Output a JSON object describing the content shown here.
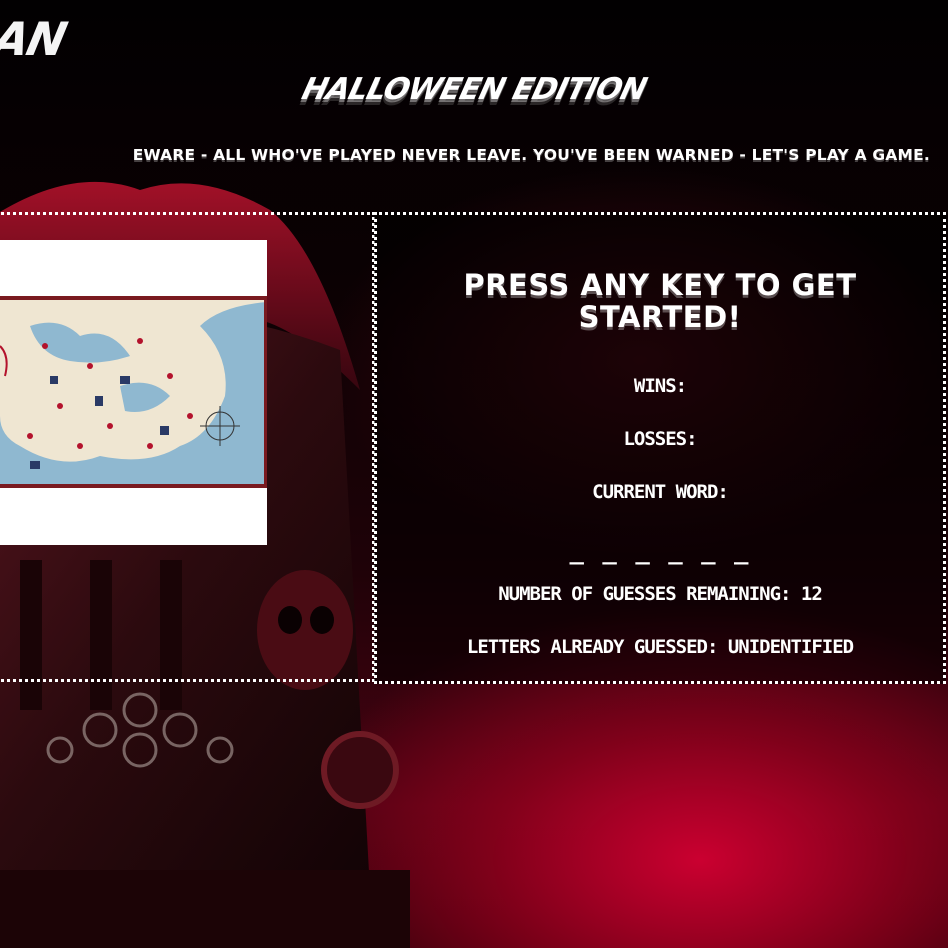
{
  "header": {
    "logo_text": "AN",
    "edition_title": "HALLOWEEN EDITION",
    "tagline": "EWARE - ALL WHO'VE PLAYED NEVER LEAVE. YOU'VE BEEN WARNED - LET'S PLAY A GAME."
  },
  "game": {
    "prompt": "PRESS ANY KEY TO GET STARTED!",
    "wins_label": "WINS:",
    "losses_label": "LOSSES:",
    "current_word_label": "CURRENT WORD:",
    "word_blanks": "_ _ _ _ _ _",
    "guesses_remaining_label": "NUMBER OF GUESSES REMAINING: 12",
    "letters_guessed_label": "LETTERS ALREADY GUESSED: UNIDENTIFIED"
  },
  "colors": {
    "text": "#ffffff",
    "accent_red": "#d20032",
    "map_ocean": "#8fb8d0",
    "map_land": "#efe6d2"
  },
  "icons": {
    "background_art": "gargoyle-tombstone",
    "map_image": "monster-map-of-north-america"
  }
}
